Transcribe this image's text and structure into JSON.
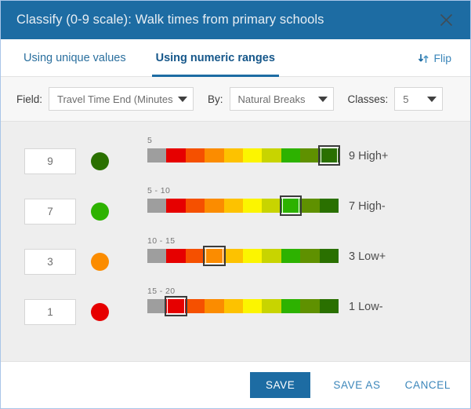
{
  "dialog": {
    "title": "Classify (0-9 scale): Walk times from primary schools",
    "close_icon": "close-icon"
  },
  "tabs": [
    {
      "label": "Using unique values",
      "active": false
    },
    {
      "label": "Using numeric ranges",
      "active": true
    }
  ],
  "flip": {
    "label": "Flip",
    "icon": "down-up-arrows-icon"
  },
  "options": {
    "field_label": "Field:",
    "field_value": "Travel Time End (Minutes)",
    "by_label": "By:",
    "by_value": "Natural Breaks",
    "classes_label": "Classes:",
    "classes_value": "5"
  },
  "ramp_colors": [
    "#9e9e9e",
    "#e60000",
    "#f55000",
    "#fb8c00",
    "#fdc200",
    "#fcf500",
    "#c8d400",
    "#2db200",
    "#5f9100",
    "#2a7000"
  ],
  "classes": [
    {
      "value": "9",
      "dot_color": "#2a7000",
      "range_label": "5",
      "selected_index": 9,
      "label": "9 High+"
    },
    {
      "value": "7",
      "dot_color": "#2db200",
      "range_label": "5 - 10",
      "selected_index": 7,
      "label": "7 High-"
    },
    {
      "value": "3",
      "dot_color": "#fb8c00",
      "range_label": "10 - 15",
      "selected_index": 3,
      "label": "3 Low+"
    },
    {
      "value": "1",
      "dot_color": "#e60000",
      "range_label": "15 - 20",
      "selected_index": 1,
      "label": "1 Low-"
    }
  ],
  "footer": {
    "save": "SAVE",
    "save_as": "SAVE AS",
    "cancel": "CANCEL"
  },
  "theme": {
    "header_blue": "#1d6ca3",
    "link_blue": "#3b86ba",
    "body_gray": "#eeeeee"
  }
}
